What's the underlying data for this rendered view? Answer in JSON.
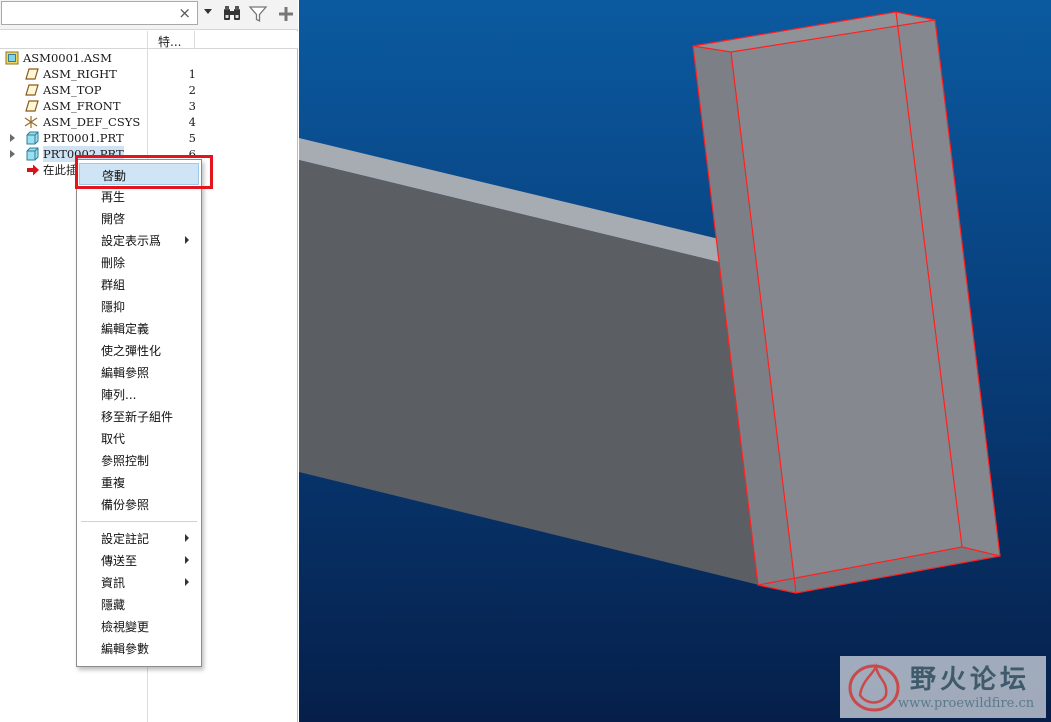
{
  "search": {
    "value": "",
    "placeholder": "",
    "clear_glyph": "×"
  },
  "toolbar_icons": [
    "binoculars-icon",
    "filter-icon",
    "plus-icon"
  ],
  "tree": {
    "column_header": "特...",
    "items": [
      {
        "label": "ASM0001.ASM",
        "num": "",
        "icon": "assembly-icon"
      },
      {
        "label": "ASM_RIGHT",
        "num": "1",
        "icon": "datum-plane-icon"
      },
      {
        "label": "ASM_TOP",
        "num": "2",
        "icon": "datum-plane-icon"
      },
      {
        "label": "ASM_FRONT",
        "num": "3",
        "icon": "datum-plane-icon"
      },
      {
        "label": "ASM_DEF_CSYS",
        "num": "4",
        "icon": "coordinate-system-icon"
      },
      {
        "label": "PRT0001.PRT",
        "num": "5",
        "icon": "part-icon"
      },
      {
        "label": "PRT0002.PRT",
        "num": "6",
        "icon": "part-icon"
      },
      {
        "label": "在此插入",
        "num": "",
        "icon": "insert-here-arrow-icon"
      }
    ]
  },
  "context_menu": {
    "items": [
      {
        "label": "啓動",
        "submenu": false
      },
      {
        "label": "再生",
        "submenu": false
      },
      {
        "label": "開啓",
        "submenu": false
      },
      {
        "label": "設定表示爲",
        "submenu": true
      },
      {
        "label": "刪除",
        "submenu": false
      },
      {
        "label": "群組",
        "submenu": false
      },
      {
        "label": "隱抑",
        "submenu": false
      },
      {
        "label": "編輯定義",
        "submenu": false
      },
      {
        "label": "使之彈性化",
        "submenu": false
      },
      {
        "label": "編輯參照",
        "submenu": false
      },
      {
        "label": "陣列...",
        "submenu": false
      },
      {
        "label": "移至新子組件",
        "submenu": false
      },
      {
        "label": "取代",
        "submenu": false
      },
      {
        "label": "參照控制",
        "submenu": false
      },
      {
        "label": "重複",
        "submenu": false
      },
      {
        "label": "備份參照",
        "submenu": false
      },
      {
        "label": "設定註記",
        "submenu": true
      },
      {
        "label": "傳送至",
        "submenu": true
      },
      {
        "label": "資訊",
        "submenu": true
      },
      {
        "label": "隱藏",
        "submenu": false
      },
      {
        "label": "檢視變更",
        "submenu": false
      },
      {
        "label": "編輯參數",
        "submenu": false
      }
    ]
  },
  "watermark": {
    "title": "野火论坛",
    "url": "www.proewildfire.cn"
  },
  "colors": {
    "highlight_box": "#e3141b",
    "edge_highlight": "#ff2020",
    "viewport_top": "#0b5aa0",
    "viewport_bottom": "#061f4a"
  }
}
